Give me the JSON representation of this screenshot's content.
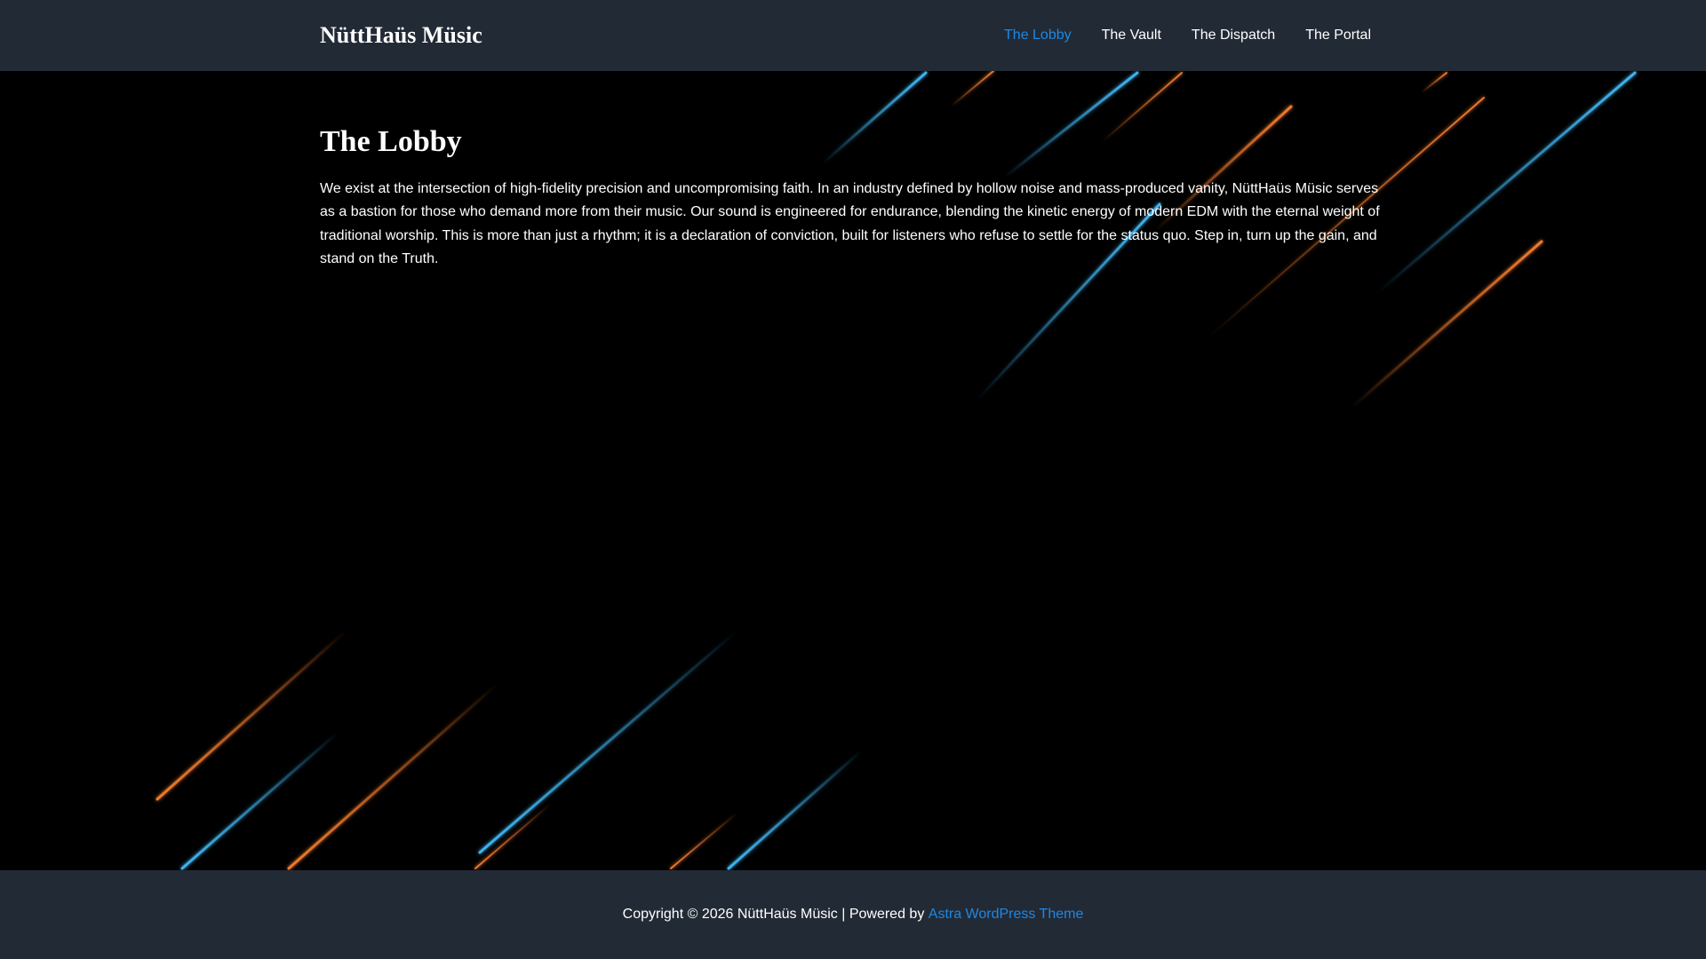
{
  "site": {
    "title": "NüttHaüs Müsic"
  },
  "nav": {
    "items": [
      {
        "label": "The Lobby",
        "active": true
      },
      {
        "label": "The Vault",
        "active": false
      },
      {
        "label": "The Dispatch",
        "active": false
      },
      {
        "label": "The Portal",
        "active": false
      }
    ]
  },
  "page": {
    "title": "The Lobby",
    "body": "We exist at the intersection of high-fidelity precision and uncompromising faith. In an industry defined by hollow noise and mass-produced vanity, NüttHaüs Müsic serves as a bastion for those who demand more from their music. Our sound is engineered for endurance, blending the kinetic energy of modern EDM with the eternal weight of traditional worship. This is more than just a rhythm; it is a declaration of conviction, built for listeners who refuse to settle for the status quo. Step in, turn up the gain, and stand on the Truth."
  },
  "footer": {
    "copyright": "Copyright © 2026 NüttHaüs Müsic | Powered by ",
    "theme_link": "Astra WordPress Theme"
  },
  "colors": {
    "header_bg": "#222a35",
    "body_bg": "#000000",
    "accent": "#1e88e5",
    "streak_blue": "#3fb4f0",
    "streak_orange": "#f07a2a"
  },
  "background": {
    "description_icon": "light-streaks-background"
  }
}
